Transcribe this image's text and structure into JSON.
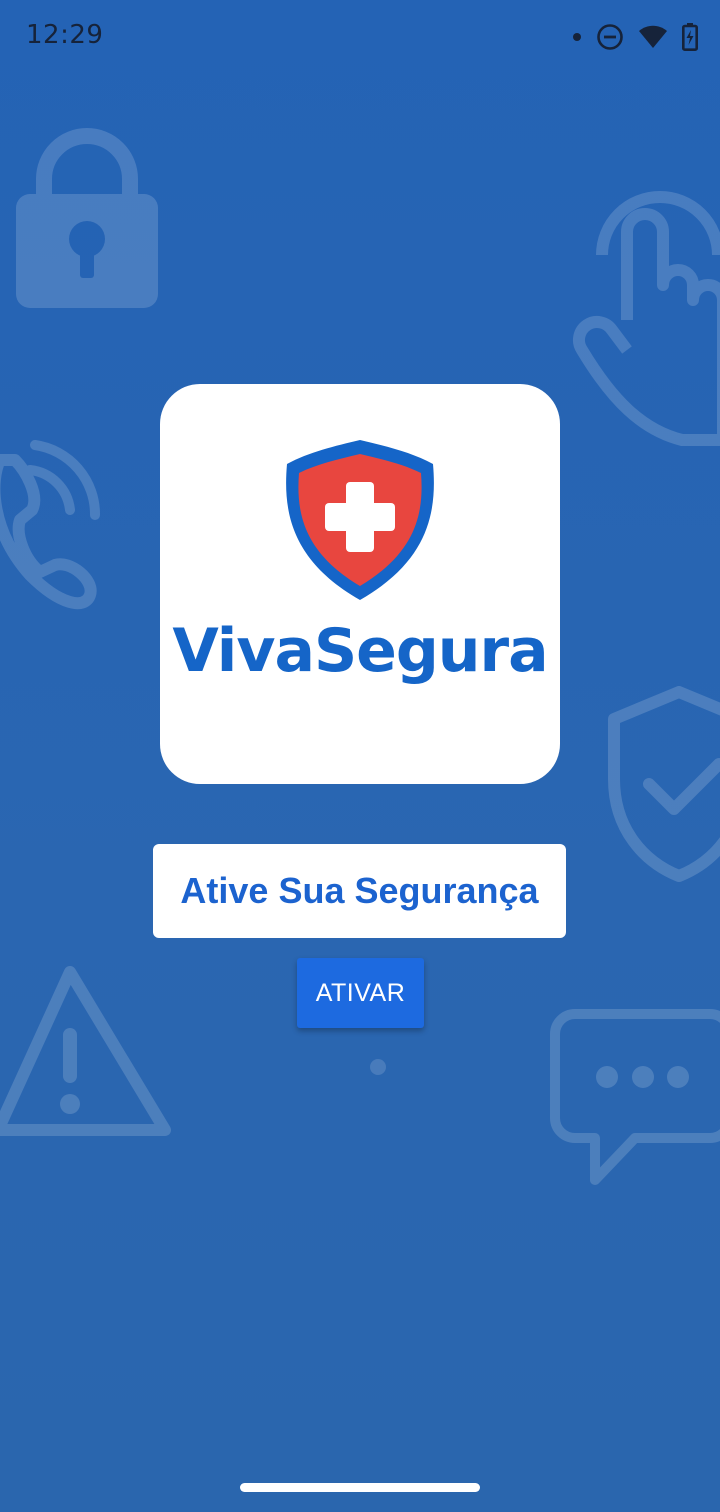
{
  "status_bar": {
    "time": "12:29",
    "icons": [
      "notification-dot-icon",
      "do-not-disturb-icon",
      "wifi-icon",
      "battery-charging-icon"
    ]
  },
  "background_icons": [
    "lock-icon",
    "touch-hand-icon",
    "phone-call-icon",
    "shield-check-icon",
    "warning-icon",
    "chat-bubble-icon"
  ],
  "logo": {
    "name": "VivaSegura",
    "icon": "shield-cross-icon",
    "colors": {
      "shield_outer": "#1565c8",
      "shield_inner": "#e8463f",
      "cross": "#ffffff",
      "text": "#1565c8"
    }
  },
  "headline": "Ative Sua Segurança",
  "activate_button": {
    "label": "ATIVAR"
  },
  "colors": {
    "background": "#2a66b1",
    "button": "#1d6ae0",
    "headline_text": "#1c63cf"
  }
}
